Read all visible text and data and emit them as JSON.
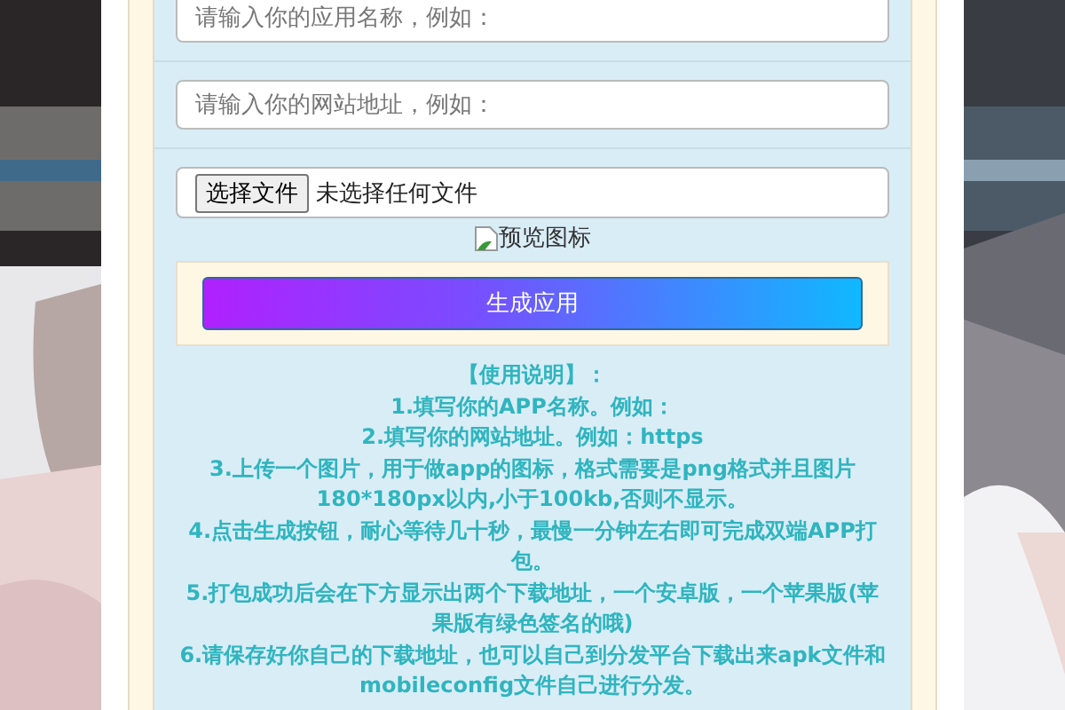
{
  "form": {
    "app_name": {
      "placeholder": "请输入你的应用名称，例如："
    },
    "site_url": {
      "placeholder": "请输入你的网站地址，例如："
    },
    "file": {
      "button": "选择文件",
      "status": "未选择任何文件"
    },
    "preview": {
      "alt": "预览图标"
    },
    "submit": "生成应用"
  },
  "instructions": {
    "title": "【使用说明】：",
    "items": [
      "1.填写你的APP名称。例如：",
      "2.填写你的网站地址。例如：https",
      "3.上传一个图片，用于做app的图标，格式需要是png格式并且图片180*180px以内,小于100kb,否则不显示。",
      "4.点击生成按钮，耐心等待几十秒，最慢一分钟左右即可完成双端APP打包。",
      "5.打包成功后会在下方显示出两个下载地址，一个安卓版，一个苹果版(苹果版有绿色签名的哦)",
      "6.请保存好你自己的下载地址，也可以自己到分发平台下载出来apk文件和mobileconfig文件自己进行分发。"
    ]
  }
}
